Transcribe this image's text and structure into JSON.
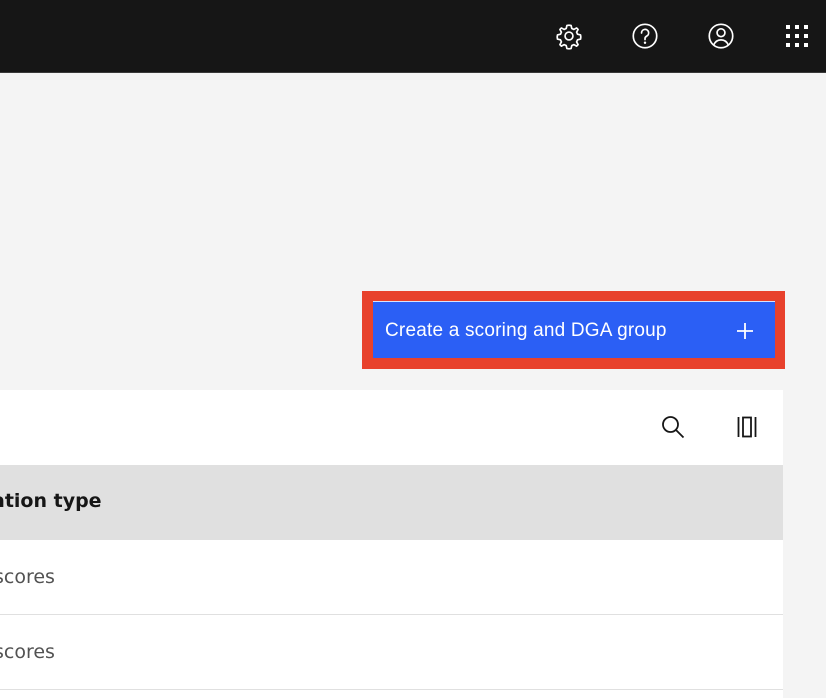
{
  "topbar": {
    "icons": [
      "gear-icon",
      "help-icon",
      "user-avatar-icon",
      "app-switcher-icon"
    ]
  },
  "actions": {
    "create_label": "Create a scoring and DGA group",
    "create_icon": "plus-icon"
  },
  "table": {
    "toolbar_icons": [
      "search-icon",
      "column-settings-icon"
    ],
    "header": {
      "col_type": "ation type"
    },
    "rows": [
      {
        "type": "scores"
      },
      {
        "type": "scores"
      }
    ]
  },
  "colors": {
    "header_bg": "#161616",
    "primary": "#2b5ff5",
    "highlight": "#e8412c"
  }
}
